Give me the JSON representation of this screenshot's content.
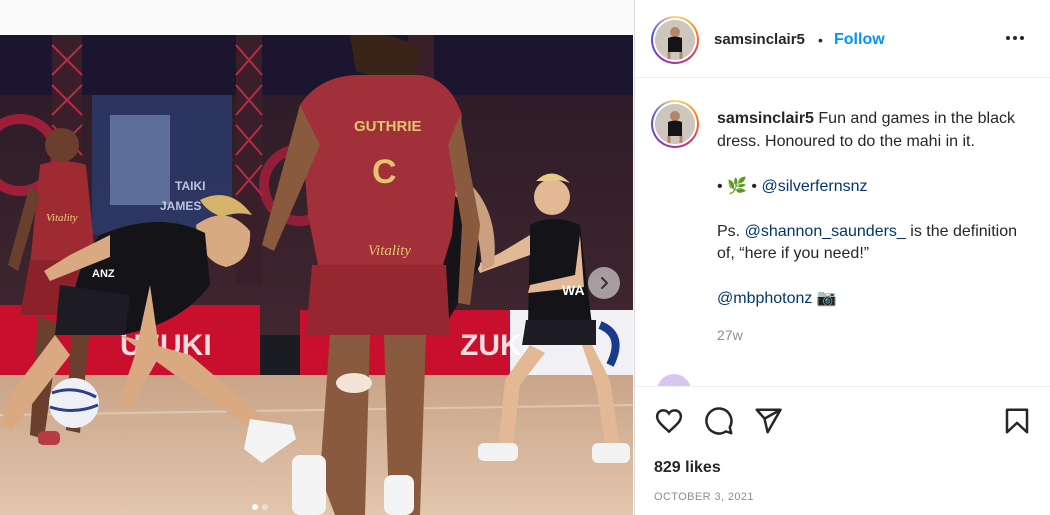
{
  "post": {
    "username": "samsinclair5",
    "separator": "•",
    "follow_label": "Follow",
    "more_icon": "more-horizontal-icon"
  },
  "caption": {
    "username": "samsinclair5",
    "line1": "Fun and games in the black dress. Honoured to do the mahi in it.",
    "line2_prefix": "• 🌿 •",
    "line2_mention": "@silverfernsnz",
    "line3_prefix": "Ps.",
    "line3_mention": "@shannon_saunders_",
    "line3_suffix": "is the definition of, “here if you need!”",
    "line4_mention": "@mbphotonz",
    "line4_emoji": "📷",
    "time_ago": "27w"
  },
  "actions": {
    "like_icon": "heart-icon",
    "comment_icon": "comment-icon",
    "share_icon": "send-icon",
    "save_icon": "bookmark-icon",
    "likes": "829 likes",
    "date": "OCTOBER 3, 2021"
  },
  "media": {
    "image": "netball-match-photo",
    "next_icon": "chevron-right-icon",
    "carousel_count": 2,
    "carousel_active": 1,
    "jersey_name": "GUTHRIE",
    "jersey_letter": "C",
    "sponsor": "Vitality",
    "banner_text": "SUZUKI"
  },
  "colors": {
    "follow": "#0095f6",
    "link": "#00376b",
    "muted": "#8e8e8e",
    "england_red": "#9e2a32",
    "silver_ferns_black": "#141418"
  }
}
